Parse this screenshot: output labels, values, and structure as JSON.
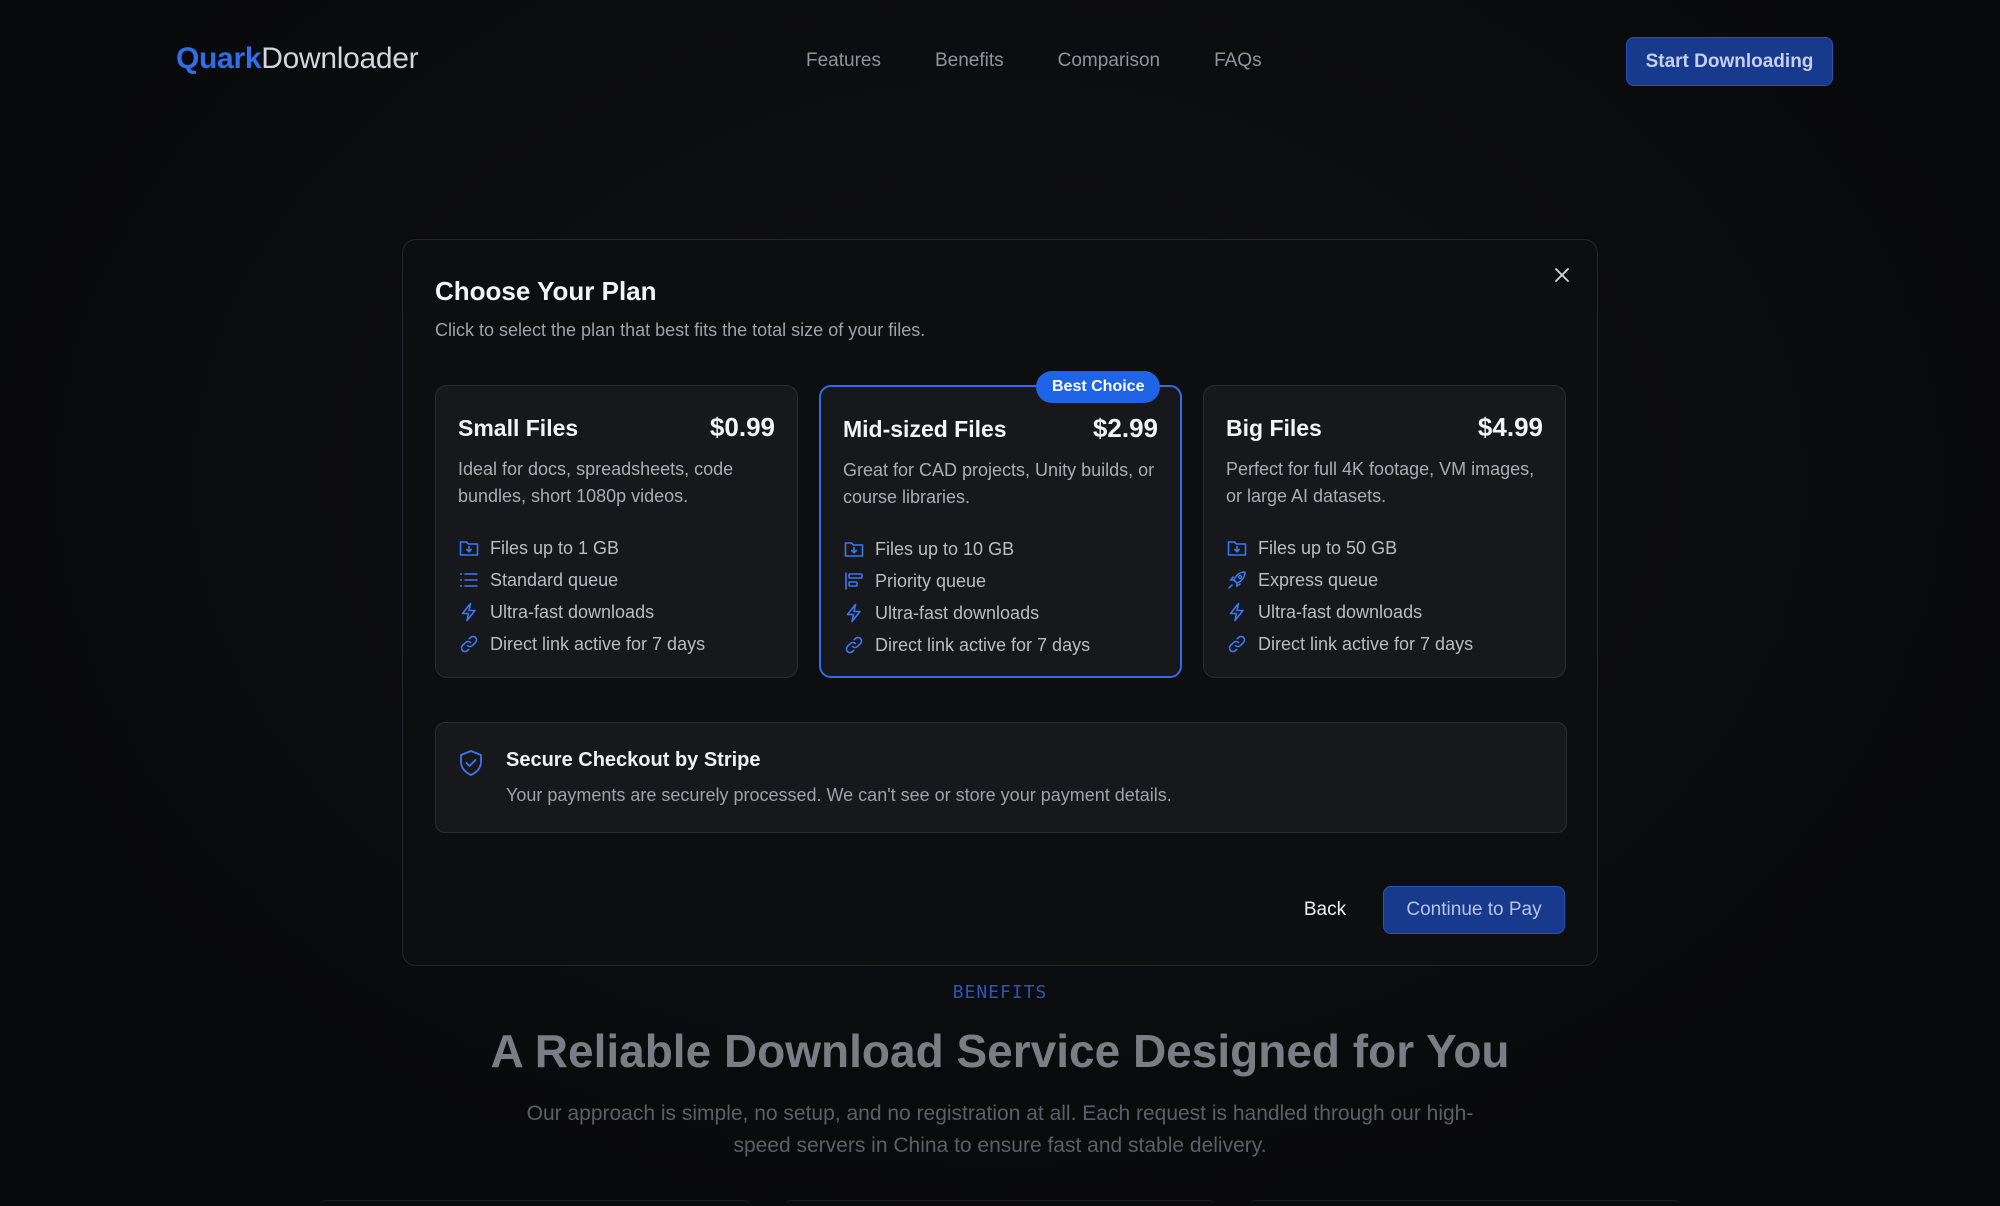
{
  "nav": {
    "logo_brand": "Quark",
    "logo_rest": "Downloader",
    "links": [
      "Features",
      "Benefits",
      "Comparison",
      "FAQs"
    ],
    "cta": "Start Downloading"
  },
  "background": {
    "eyebrow": "BENEFITS",
    "title": "A Reliable Download Service Designed for You",
    "subtitle": "Our approach is simple, no setup, and no registration at all. Each request is handled through our high-speed servers in China to ensure fast and stable delivery."
  },
  "modal": {
    "title": "Choose Your Plan",
    "subtitle": "Click to select the plan that best fits the total size of your files.",
    "plans": [
      {
        "name": "Small Files",
        "price": "$0.99",
        "description": "Ideal for docs, spreadsheets, code bundles, short 1080p videos.",
        "features": [
          "Files up to 1 GB",
          "Standard queue",
          "Ultra-fast downloads",
          "Direct link active for 7 days"
        ],
        "feature_icons": [
          "folder-download-icon",
          "list-icon",
          "bolt-icon",
          "link-icon"
        ]
      },
      {
        "name": "Mid-sized Files",
        "price": "$2.99",
        "badge": "Best Choice",
        "description": "Great for CAD projects, Unity builds, or course libraries.",
        "features": [
          "Files up to 10 GB",
          "Priority queue",
          "Ultra-fast downloads",
          "Direct link active for 7 days"
        ],
        "feature_icons": [
          "folder-download-icon",
          "priority-icon",
          "bolt-icon",
          "link-icon"
        ]
      },
      {
        "name": "Big Files",
        "price": "$4.99",
        "description": "Perfect for full 4K footage, VM images, or large AI datasets.",
        "features": [
          "Files up to 50 GB",
          "Express queue",
          "Ultra-fast downloads",
          "Direct link active for 7 days"
        ],
        "feature_icons": [
          "folder-download-icon",
          "rocket-icon",
          "bolt-icon",
          "link-icon"
        ]
      }
    ],
    "secure": {
      "title": "Secure Checkout by Stripe",
      "description": "Your payments are securely processed. We can't see or store your payment details."
    },
    "back_label": "Back",
    "pay_label": "Continue to Pay"
  },
  "colors": {
    "accent": "#2f6ce8",
    "button_bg": "#173a8c",
    "modal_bg": "#0d0e10",
    "card_bg": "#17181b"
  }
}
